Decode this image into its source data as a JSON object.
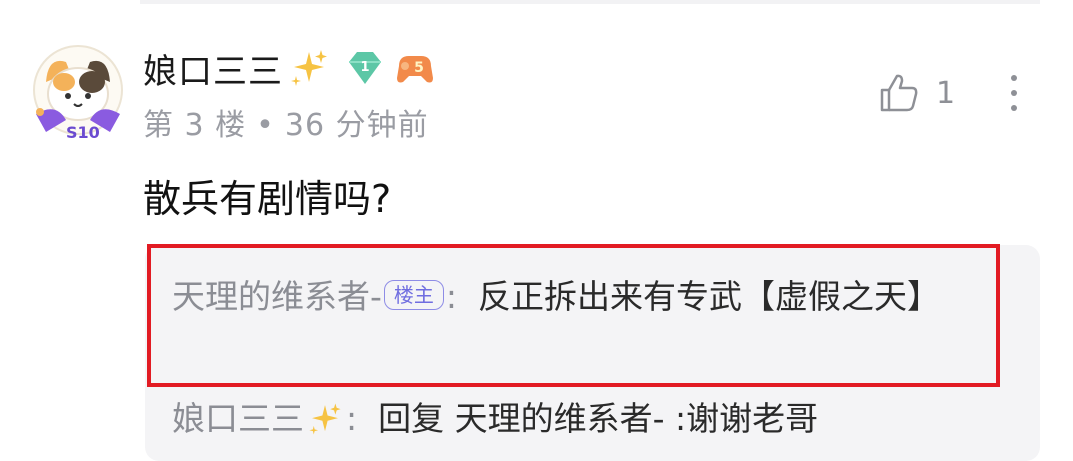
{
  "comment": {
    "username": "娘口三三",
    "level_badge": "1",
    "game_badge": "5",
    "floor": "第 3 楼",
    "separator": "•",
    "time": "36 分钟前",
    "like_count": "1",
    "content": "散兵有剧情吗?"
  },
  "replies": [
    {
      "author": "天理的维系者-",
      "tag": "楼主",
      "colon": ":",
      "text": "反正拆出来有专武【虚假之天】"
    },
    {
      "author": "娘口三三",
      "colon": ":",
      "text": "回复 天理的维系者- :谢谢老哥"
    }
  ],
  "icons": {
    "avatar": "calico-cat-avatar",
    "sparkle": "sparkles-icon",
    "level": "diamond-level-icon",
    "game": "gamepad-icon",
    "like": "thumbs-up-icon",
    "more": "more-vertical-icon"
  },
  "colors": {
    "highlight_border": "#e21b23",
    "op_tag": "#6f6de0",
    "level_badge": "#5cc7a6",
    "game_badge": "#f28a4a"
  }
}
